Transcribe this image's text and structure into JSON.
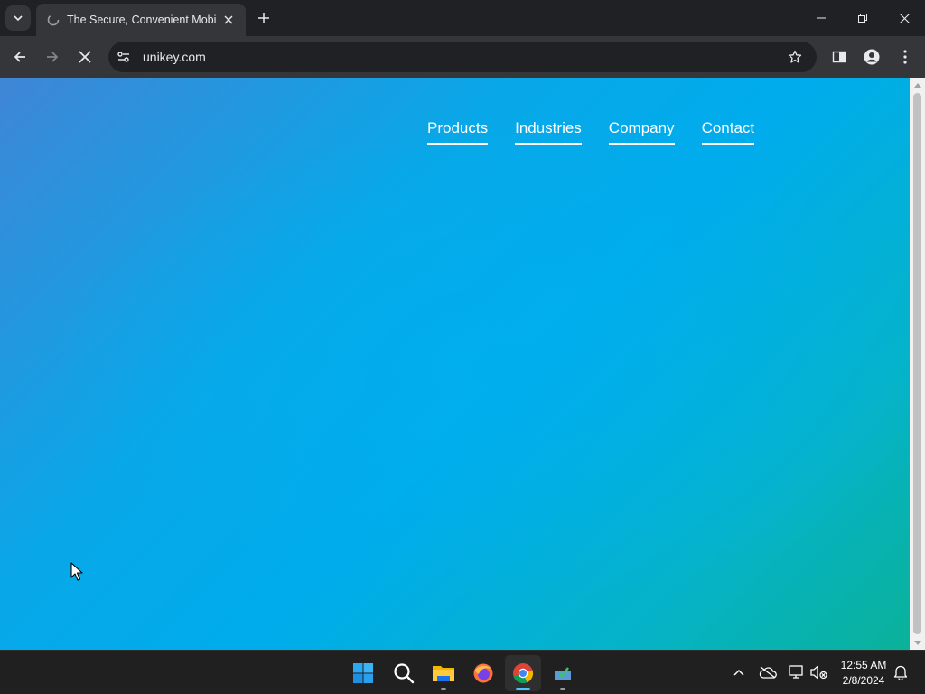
{
  "browser": {
    "tab": {
      "title": "The Secure, Convenient Mobile"
    },
    "omnibox": {
      "url": "unikey.com"
    }
  },
  "site": {
    "nav": [
      {
        "label": "Products"
      },
      {
        "label": "Industries"
      },
      {
        "label": "Company"
      },
      {
        "label": "Contact"
      }
    ],
    "colors": {
      "gradient_start": "#3f86d6",
      "gradient_mid": "#00acec",
      "gradient_end": "#0ab299",
      "nav_text": "#ffffff"
    }
  },
  "taskbar": {
    "apps": [
      "start-icon",
      "search-icon",
      "file-explorer-icon",
      "firefox-icon",
      "chrome-icon",
      "app-icon"
    ],
    "active_app": "chrome-icon",
    "clock": {
      "time": "12:55 AM",
      "date": "2/8/2024"
    }
  }
}
